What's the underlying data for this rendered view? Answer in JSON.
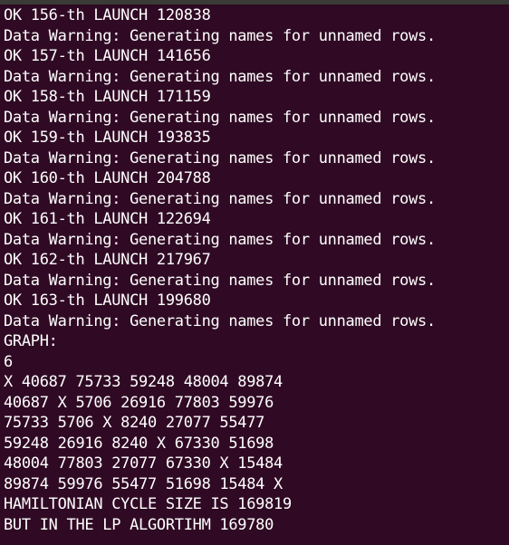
{
  "terminal": {
    "background": "#300a24",
    "foreground": "#ffffff",
    "lines": [
      "OK 156-th LAUNCH 120838",
      "Data Warning: Generating names for unnamed rows.",
      "OK 157-th LAUNCH 141656",
      "Data Warning: Generating names for unnamed rows.",
      "OK 158-th LAUNCH 171159",
      "Data Warning: Generating names for unnamed rows.",
      "OK 159-th LAUNCH 193835",
      "Data Warning: Generating names for unnamed rows.",
      "OK 160-th LAUNCH 204788",
      "Data Warning: Generating names for unnamed rows.",
      "OK 161-th LAUNCH 122694",
      "Data Warning: Generating names for unnamed rows.",
      "OK 162-th LAUNCH 217967",
      "Data Warning: Generating names for unnamed rows.",
      "OK 163-th LAUNCH 199680",
      "Data Warning: Generating names for unnamed rows.",
      "GRAPH:",
      "6",
      "X 40687 75733 59248 48004 89874",
      "40687 X 5706 26916 77803 59976",
      "75733 5706 X 8240 27077 55477",
      "59248 26916 8240 X 67330 51698",
      "48004 77803 27077 67330 X 15484",
      "89874 59976 55477 51698 15484 X",
      "HAMILTONIAN CYCLE SIZE IS 169819",
      "BUT IN THE LP ALGORTIHM 169780"
    ]
  }
}
